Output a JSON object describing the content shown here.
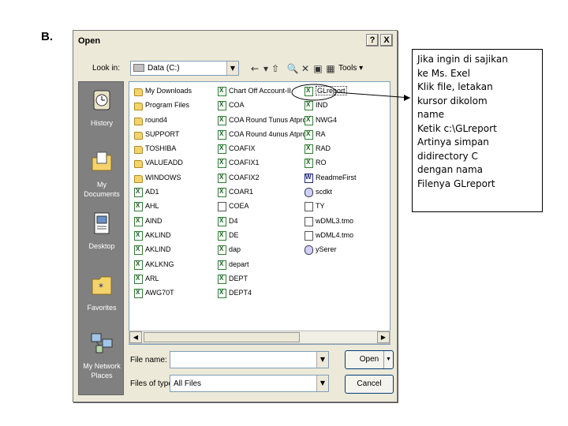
{
  "slide": {
    "label": "B."
  },
  "dialog": {
    "title": "Open",
    "help_button": "?",
    "close_button": "X",
    "look_in_label": "Look in:",
    "look_in_value": "Data (C:)",
    "tools_label": "Tools",
    "places": [
      {
        "label": "History",
        "icon": "history-icon"
      },
      {
        "label": "My Documents",
        "icon": "my-documents-icon"
      },
      {
        "label": "Desktop",
        "icon": "desktop-icon"
      },
      {
        "label": "Favorites",
        "icon": "favorites-icon"
      },
      {
        "label": "My Network Places",
        "icon": "network-places-icon"
      }
    ],
    "files": {
      "column1": [
        {
          "name": "My Downloads",
          "type": "folder"
        },
        {
          "name": "Program Files",
          "type": "folder"
        },
        {
          "name": "round4",
          "type": "folder"
        },
        {
          "name": "SUPPORT",
          "type": "folder"
        },
        {
          "name": "TOSHIBA",
          "type": "folder"
        },
        {
          "name": "VALUEADD",
          "type": "folder"
        },
        {
          "name": "WINDOWS",
          "type": "folder"
        },
        {
          "name": "AD1",
          "type": "xls"
        },
        {
          "name": "AHL",
          "type": "xls"
        },
        {
          "name": "AIND",
          "type": "xls"
        },
        {
          "name": "AKLIND",
          "type": "xls"
        },
        {
          "name": "AKLIND",
          "type": "xls"
        },
        {
          "name": "AKLKNG",
          "type": "xls"
        },
        {
          "name": "ARL",
          "type": "xls"
        },
        {
          "name": "AWG70T",
          "type": "xls"
        }
      ],
      "column2": [
        {
          "name": "Chart Off Account-II",
          "type": "xls"
        },
        {
          "name": "COA",
          "type": "xls"
        },
        {
          "name": "COA Round Tunus Atpro",
          "type": "xls"
        },
        {
          "name": "COA Round 4unus Atpro",
          "type": "xls"
        },
        {
          "name": "COAFIX",
          "type": "xls"
        },
        {
          "name": "COAFIX1",
          "type": "xls"
        },
        {
          "name": "COAFIX2",
          "type": "xls"
        },
        {
          "name": "COAR1",
          "type": "xls"
        },
        {
          "name": "COEA",
          "type": "doc"
        },
        {
          "name": "D4",
          "type": "xls"
        },
        {
          "name": "DE",
          "type": "xls"
        },
        {
          "name": "dap",
          "type": "xls"
        },
        {
          "name": "depart",
          "type": "xls"
        },
        {
          "name": "DEPT",
          "type": "xls"
        },
        {
          "name": "DEPT4",
          "type": "xls"
        }
      ],
      "column3": [
        {
          "name": "GLreport",
          "type": "xls",
          "selected": true
        },
        {
          "name": "IND",
          "type": "xls"
        },
        {
          "name": "NWG4",
          "type": "xls"
        },
        {
          "name": "RA",
          "type": "xls"
        },
        {
          "name": "RAD",
          "type": "xls"
        },
        {
          "name": "RO",
          "type": "xls"
        },
        {
          "name": "ReadmeFirst",
          "type": "wrd"
        },
        {
          "name": "scdkt",
          "type": "sys"
        },
        {
          "name": "TY",
          "type": "doc"
        },
        {
          "name": "wDML3.tmo",
          "type": "doc"
        },
        {
          "name": "wDML4.tmo",
          "type": "doc"
        },
        {
          "name": "ySerer",
          "type": "sys"
        }
      ]
    },
    "file_name_label": "File name:",
    "file_name_value": "",
    "files_of_type_label": "Files of type:",
    "files_of_type_value": "All Files",
    "open_button": "Open",
    "cancel_button": "Cancel"
  },
  "callout": {
    "lines": [
      "Jika ingin di sajikan",
      "ke Ms. Exel",
      "Klik file, letakan",
      "kursor dikolom",
      "name",
      "Ketik    c:\\GLreport",
      "Artinya simpan",
      "didirectory  C",
      "dengan nama",
      "Filenya GLreport"
    ]
  },
  "colors": {
    "dialog_bg": "#ece9d8",
    "places_bg": "#808080",
    "field_border": "#7f9db9",
    "button_border": "#003c74"
  }
}
